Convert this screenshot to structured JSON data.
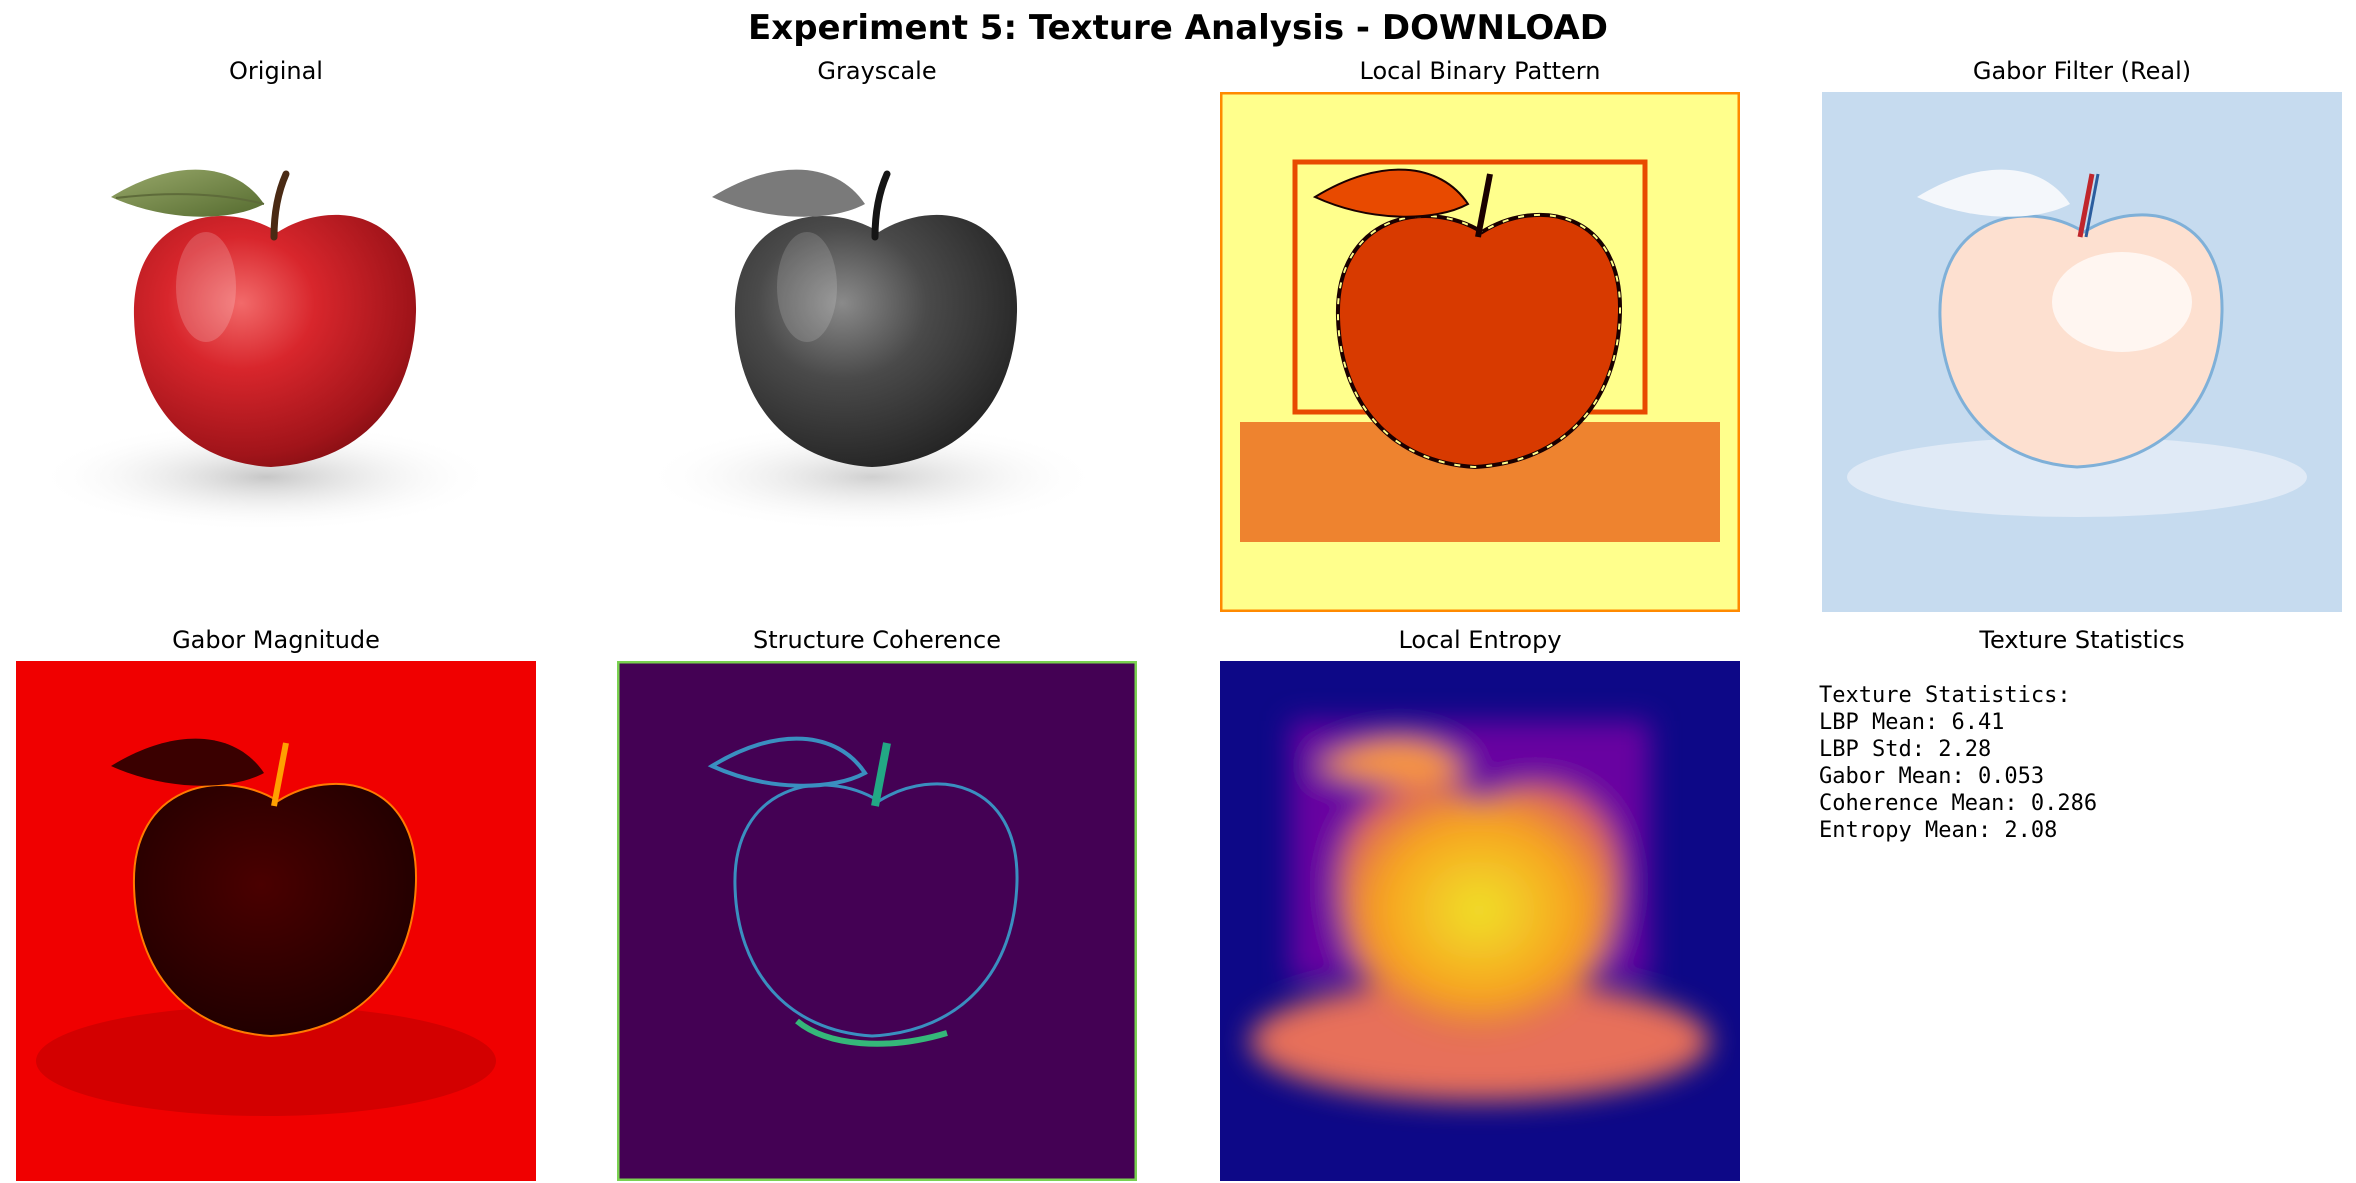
{
  "figure": {
    "title": "Experiment 5: Texture Analysis - DOWNLOAD"
  },
  "panels": [
    {
      "title": "Original"
    },
    {
      "title": "Grayscale"
    },
    {
      "title": "Local Binary Pattern"
    },
    {
      "title": "Gabor Filter (Real)"
    },
    {
      "title": "Gabor Magnitude"
    },
    {
      "title": "Structure Coherence"
    },
    {
      "title": "Local Entropy"
    },
    {
      "title": "Texture Statistics"
    }
  ],
  "stats": {
    "heading": "Texture Statistics:",
    "lines": [
      "LBP Mean: 6.41",
      "LBP Std: 2.28",
      "Gabor Mean: 0.053",
      "Coherence Mean: 0.286",
      "Entropy Mean: 2.08"
    ]
  },
  "colors": {
    "apple_red": "#d8262c",
    "lbp_background": "#ffff8c",
    "lbp_edges": "#e84a00",
    "gabor_real_background": "#c6dbef",
    "gabor_mag_background": "#f00000",
    "coherence_background": "#440154",
    "coherence_edges": "#3a8fc0",
    "entropy_background": "#0d0887",
    "entropy_high": "#f0e22a"
  }
}
